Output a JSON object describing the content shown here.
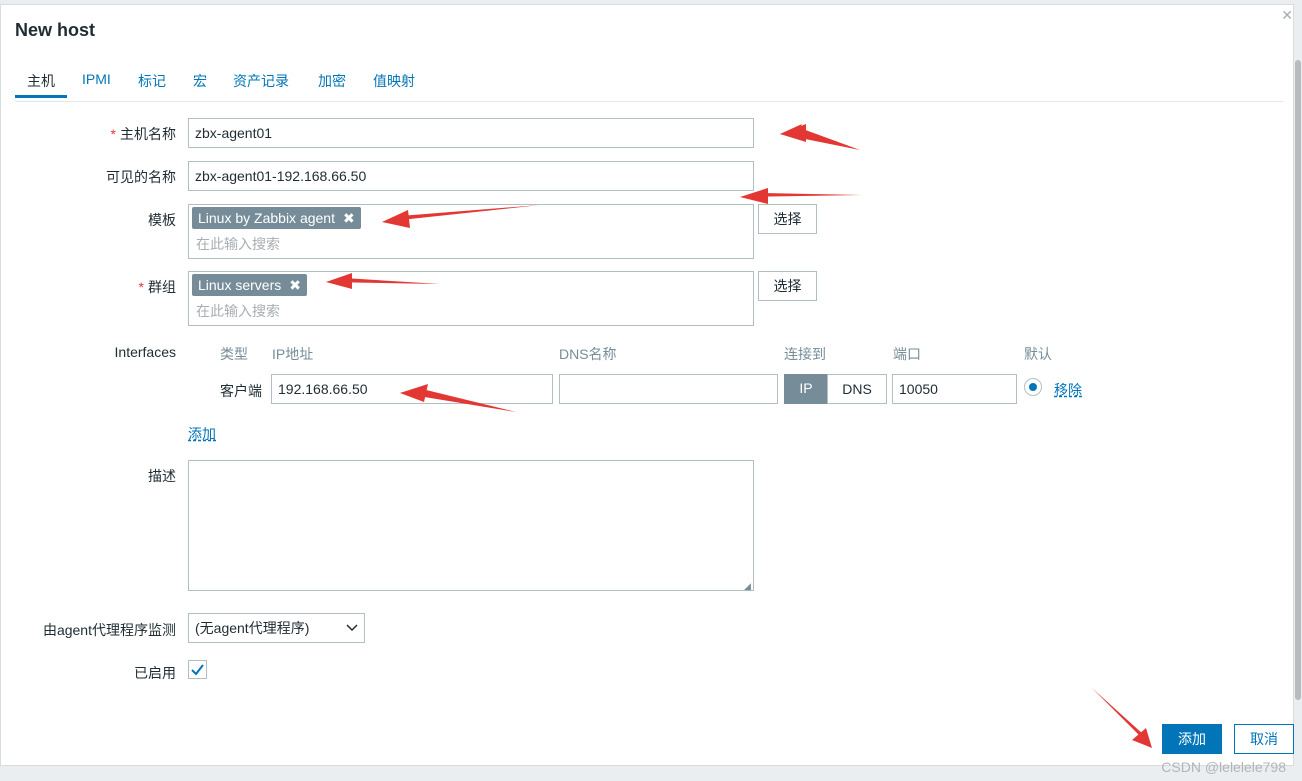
{
  "dialog": {
    "title": "New host",
    "close_icon": "close-icon"
  },
  "tabs": [
    {
      "label": "主机",
      "active": true
    },
    {
      "label": "IPMI"
    },
    {
      "label": "标记"
    },
    {
      "label": "宏"
    },
    {
      "label": "资产记录"
    },
    {
      "label": "加密"
    },
    {
      "label": "值映射"
    }
  ],
  "form": {
    "required_mark": "*",
    "host_name": {
      "label": "主机名称",
      "value": "zbx-agent01"
    },
    "visible_name": {
      "label": "可见的名称",
      "value": "zbx-agent01-192.168.66.50"
    },
    "templates": {
      "label": "模板",
      "chip": "Linux by Zabbix agent",
      "chip_remove": "✖",
      "placeholder": "在此输入搜索",
      "select_label": "选择"
    },
    "groups": {
      "label": "群组",
      "chip": "Linux servers",
      "chip_remove": "✖",
      "placeholder": "在此输入搜索",
      "select_label": "选择"
    },
    "interfaces": {
      "label": "Interfaces",
      "headers": {
        "type": "类型",
        "ip": "IP地址",
        "dns": "DNS名称",
        "connect": "连接到",
        "port": "端口",
        "default": "默认"
      },
      "row": {
        "type": "客户端",
        "ip": "192.168.66.50",
        "dns": "",
        "connect_ip": "IP",
        "connect_dns": "DNS",
        "port": "10050",
        "remove": "移除"
      },
      "add": "添加"
    },
    "description": {
      "label": "描述",
      "value": ""
    },
    "proxy": {
      "label": "由agent代理程序监测",
      "selected": "(无agent代理程序)"
    },
    "enabled": {
      "label": "已启用",
      "checked": true
    }
  },
  "buttons": {
    "add": "添加",
    "cancel": "取消"
  },
  "watermark": "CSDN @lelelele798",
  "colors": {
    "accent": "#0275b8",
    "chip": "#768d99",
    "annotation": "#e33734"
  }
}
